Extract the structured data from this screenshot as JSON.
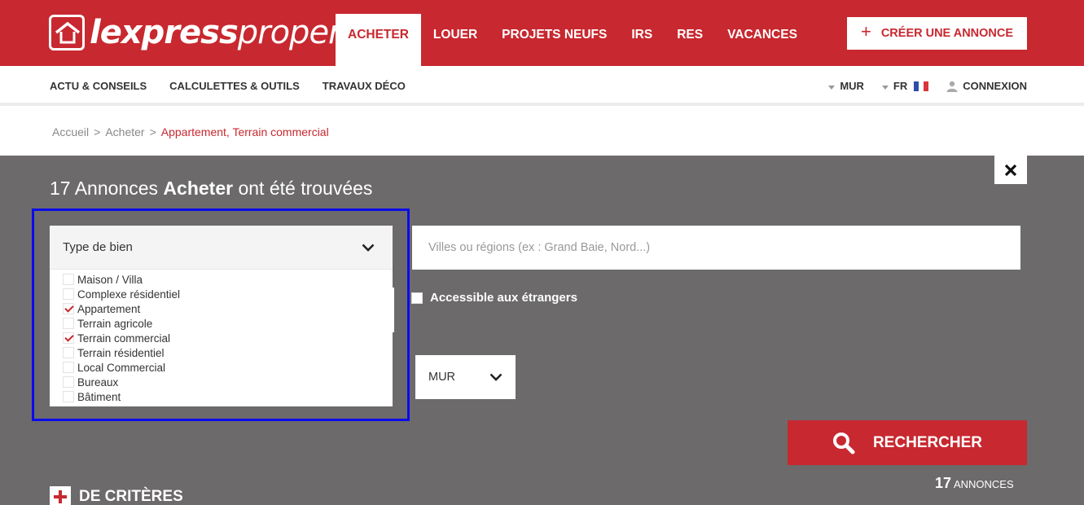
{
  "brand": {
    "name_bold": "lexpress",
    "name_light": "property"
  },
  "main_nav": [
    {
      "label": "ACHETER",
      "active": true
    },
    {
      "label": "LOUER",
      "active": false
    },
    {
      "label": "PROJETS NEUFS",
      "active": false
    },
    {
      "label": "IRS",
      "active": false
    },
    {
      "label": "RES",
      "active": false
    },
    {
      "label": "VACANCES",
      "active": false
    }
  ],
  "create_button": {
    "label": "CRÉER UNE ANNONCE",
    "icon": "plus-icon"
  },
  "sub_nav": {
    "links": [
      "ACTU & CONSEILS",
      "CALCULETTES & OUTILS",
      "TRAVAUX DÉCO"
    ],
    "currency": "MUR",
    "language": "FR",
    "login": "CONNEXION"
  },
  "breadcrumb": {
    "items": [
      "Accueil",
      "Acheter"
    ],
    "current": "Appartement, Terrain commercial",
    "separator": ">"
  },
  "results": {
    "count": "17",
    "pre": "Annonces",
    "keyword": "Acheter",
    "post": "ont été trouvées"
  },
  "type_dropdown": {
    "label": "Type de bien",
    "options": [
      {
        "label": "Maison / Villa",
        "checked": false
      },
      {
        "label": "Complexe résidentiel",
        "checked": false
      },
      {
        "label": "Appartement",
        "checked": true
      },
      {
        "label": "Terrain agricole",
        "checked": false
      },
      {
        "label": "Terrain commercial",
        "checked": true
      },
      {
        "label": "Terrain résidentiel",
        "checked": false
      },
      {
        "label": "Local Commercial",
        "checked": false
      },
      {
        "label": "Bureaux",
        "checked": false
      },
      {
        "label": "Bâtiment",
        "checked": false
      }
    ]
  },
  "location_input": {
    "placeholder": "Villes ou régions (ex : Grand Baie, Nord...)",
    "value": ""
  },
  "foreign_access": {
    "label": "Accessible aux étrangers",
    "checked": false
  },
  "currency_select": {
    "value": "MUR"
  },
  "search_button": {
    "label": "RECHERCHER"
  },
  "count_summary": {
    "number": "17",
    "label": "ANNONCES"
  },
  "more_criteria": {
    "label": "DE CRITÈRES"
  },
  "colors": {
    "brand_red": "#c8282f",
    "panel_gray": "#6c6a6b",
    "highlight_blue": "#0b0bea"
  }
}
